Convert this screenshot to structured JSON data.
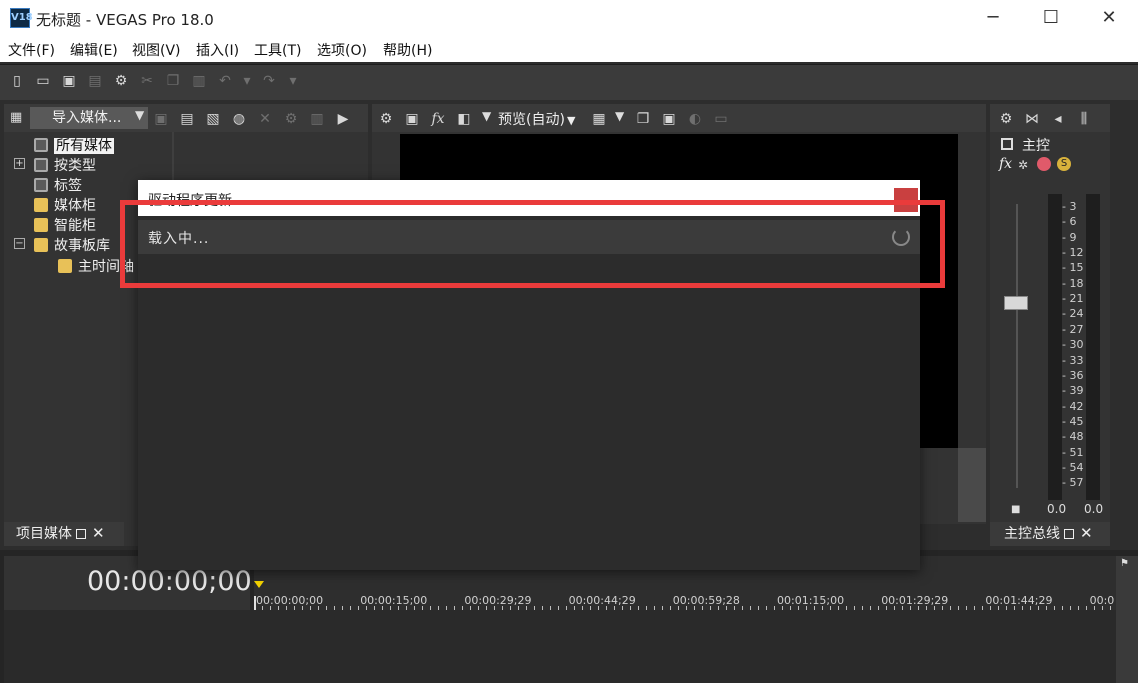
{
  "window": {
    "title": "无标题 - VEGAS Pro 18.0",
    "logo_text": "V18",
    "minimize": "─",
    "maximize": "☐",
    "close": "✕"
  },
  "menu": [
    "文件(F)",
    "编辑(E)",
    "视图(V)",
    "插入(I)",
    "工具(T)",
    "选项(O)",
    "帮助(H)"
  ],
  "toolbar_icons": [
    "new-file",
    "open-folder",
    "save",
    "properties",
    "settings-gear",
    "cut",
    "copy",
    "paste",
    "undo",
    "redo"
  ],
  "media_pane": {
    "import_label": "导入媒体...",
    "tree": [
      {
        "label": "所有媒体",
        "selected": true
      },
      {
        "label": "按类型",
        "expander": "+"
      },
      {
        "label": "标签"
      },
      {
        "label": "媒体柜"
      },
      {
        "label": "智能柜"
      },
      {
        "label": "故事板库",
        "expander": "−"
      },
      {
        "label": "主时间轴"
      }
    ],
    "tab_label": "项目媒体"
  },
  "preview_toolbar": {
    "fx_label": "fx",
    "preview_mode": "预览(自动)"
  },
  "master": {
    "label": "主控",
    "fx_label": "fx",
    "db_labels": [
      "3",
      "6",
      "9",
      "12",
      "15",
      "18",
      "21",
      "24",
      "27",
      "30",
      "33",
      "36",
      "39",
      "42",
      "45",
      "48",
      "51",
      "54",
      "57"
    ],
    "left_value": "0.0",
    "right_value": "0.0",
    "tab_label": "主控总线"
  },
  "timeline": {
    "timecode": "00:00:00;00",
    "ruler": [
      "00:00:00;00",
      "00:00:15;00",
      "00:00:29;29",
      "00:00:44;29",
      "00:00:59;28",
      "00:01:15;00",
      "00:01:29;29",
      "00:01:44;29",
      "00:0"
    ]
  },
  "dialog": {
    "title": "驱动程序更新",
    "loading_text": "载入中..."
  },
  "colors": {
    "highlight": "#ea3b3b",
    "dialog_close": "#c94040",
    "background": "#2d2d2d"
  }
}
